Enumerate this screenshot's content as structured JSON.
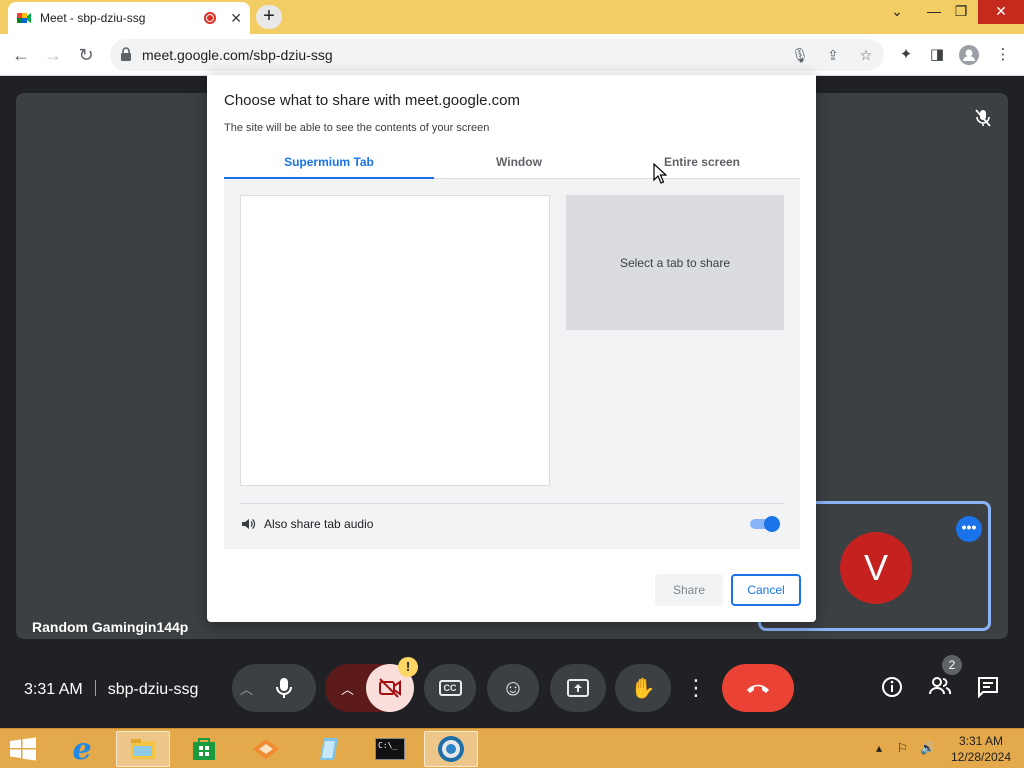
{
  "browser": {
    "tab_title": "Meet - sbp-dziu-ssg",
    "new_tab": "+",
    "url": "meet.google.com/sbp-dziu-ssg"
  },
  "meet": {
    "presenter_name": "Random Gamingin144p",
    "participant_initial": "V",
    "time": "3:31 AM",
    "meeting_code": "sbp-dziu-ssg",
    "participant_count": "2",
    "warning_mark": "!"
  },
  "dialog": {
    "title": "Choose what to share with meet.google.com",
    "subtitle": "The site will be able to see the contents of your screen",
    "tabs": [
      {
        "label": "Supermium Tab",
        "active": true
      },
      {
        "label": "Window",
        "active": false
      },
      {
        "label": "Entire screen",
        "active": false
      }
    ],
    "preview_text": "Select a tab to share",
    "audio_label": "Also share tab audio",
    "audio_enabled": true,
    "share_label": "Share",
    "cancel_label": "Cancel"
  },
  "taskbar": {
    "clock_time": "3:31 AM",
    "clock_date": "12/28/2024"
  },
  "colors": {
    "tabstrip": "#f2cd63",
    "accent": "#1a73e8",
    "end_call": "#ea4335",
    "avatar": "#c5221f",
    "taskbar": "#e3a94a"
  }
}
